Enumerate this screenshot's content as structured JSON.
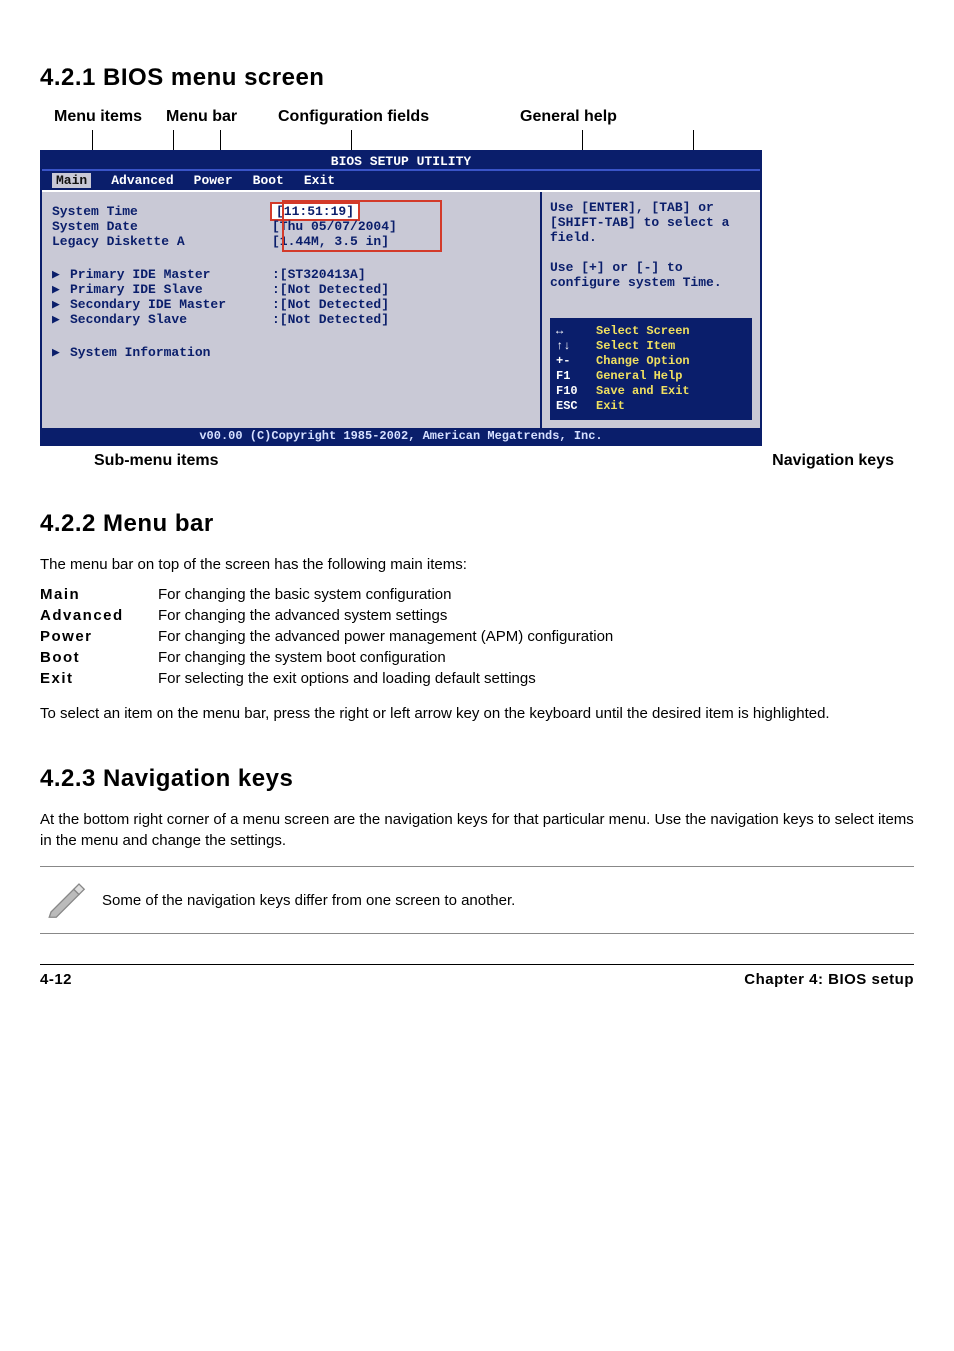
{
  "section_421": {
    "heading": "4.2.1   BIOS menu screen",
    "callouts_top": [
      "Menu items",
      "Menu bar",
      "Configuration fields",
      "General help"
    ],
    "callouts_bottom_left": "Sub-menu items",
    "callouts_bottom_right": "Navigation keys",
    "bios": {
      "title": "BIOS SETUP UTILITY",
      "menus": [
        "Main",
        "Advanced",
        "Power",
        "Boot",
        "Exit"
      ],
      "selected_menu_index": 0,
      "items": [
        {
          "label": "System Time",
          "value": "[11:51:19]",
          "submenu": false,
          "boxed": true
        },
        {
          "label": "System Date",
          "value": "[Thu 05/07/2004]",
          "submenu": false
        },
        {
          "label": "Legacy Diskette A",
          "value": "[1.44M, 3.5 in]",
          "submenu": false
        }
      ],
      "items2": [
        {
          "label": "Primary IDE Master",
          "value": ":[ST320413A]",
          "submenu": true
        },
        {
          "label": "Primary IDE Slave",
          "value": ":[Not Detected]",
          "submenu": true
        },
        {
          "label": "Secondary IDE Master",
          "value": ":[Not Detected]",
          "submenu": true
        },
        {
          "label": "Secondary Slave",
          "value": ":[Not Detected]",
          "submenu": true
        }
      ],
      "items3": [
        {
          "label": "System Information",
          "value": "",
          "submenu": true
        }
      ],
      "help_text": "Use [ENTER], [TAB] or [SHIFT-TAB] to select a field.\n\nUse [+] or [-] to configure system Time.",
      "nav_keys": [
        {
          "key": "↔",
          "desc": "Select Screen"
        },
        {
          "key": "↑↓",
          "desc": "Select Item"
        },
        {
          "key": "+-",
          "desc": "Change Option"
        },
        {
          "key": "F1",
          "desc": "General Help"
        },
        {
          "key": "F10",
          "desc": "Save and Exit"
        },
        {
          "key": "ESC",
          "desc": "Exit"
        }
      ],
      "footer": "v00.00 (C)Copyright 1985-2002, American Megatrends, Inc."
    }
  },
  "section_422": {
    "heading": "4.2.2   Menu bar",
    "intro": "The menu bar on top of the screen has the following main items:",
    "defs": [
      {
        "term": "Main",
        "desc": "For changing the basic system configuration"
      },
      {
        "term": "Advanced",
        "desc": "For changing the advanced system settings"
      },
      {
        "term": "Power",
        "desc": "For changing the advanced power management (APM) configuration"
      },
      {
        "term": "Boot",
        "desc": "For changing the system boot configuration"
      },
      {
        "term": "Exit",
        "desc": "For selecting the exit options and loading default settings"
      }
    ],
    "outro": "To select an item on the menu bar, press the right or left arrow key on the keyboard until the desired item is highlighted."
  },
  "section_423": {
    "heading": "4.2.3   Navigation keys",
    "para": "At the bottom right corner of a menu screen are the navigation keys for that particular menu. Use the navigation keys to select items in the menu and change the settings.",
    "note": "Some of the navigation keys differ from one screen to another."
  },
  "footer": {
    "left": "4-12",
    "right": "Chapter 4: BIOS setup"
  }
}
